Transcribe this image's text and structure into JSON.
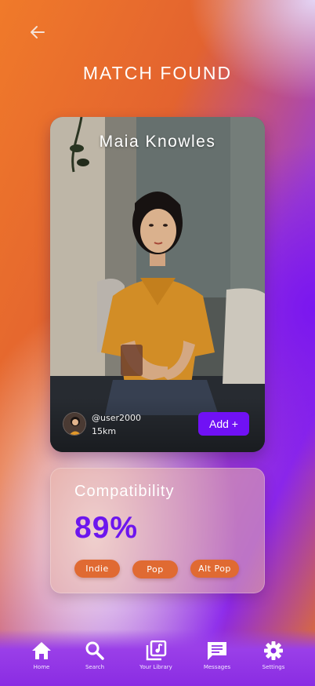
{
  "header": {
    "back_icon": "arrow-left-icon",
    "title": "MATCH FOUND"
  },
  "profile": {
    "name": "Maia Knowles",
    "handle": "@user2000",
    "distance": "15km",
    "add_label": "Add +"
  },
  "compatibility": {
    "title": "Compatibility",
    "score": "89%",
    "tags": [
      "Indie",
      "Pop",
      "Alt Pop"
    ]
  },
  "nav": {
    "items": [
      {
        "label": "Home",
        "icon": "home-icon"
      },
      {
        "label": "Search",
        "icon": "search-icon"
      },
      {
        "label": "Your Library",
        "icon": "library-music-icon"
      },
      {
        "label": "Messages",
        "icon": "message-icon"
      },
      {
        "label": "Settings",
        "icon": "gear-icon"
      }
    ]
  },
  "colors": {
    "accent": "#7011f5",
    "tag": "#e06a32",
    "score": "#6d16ee"
  }
}
